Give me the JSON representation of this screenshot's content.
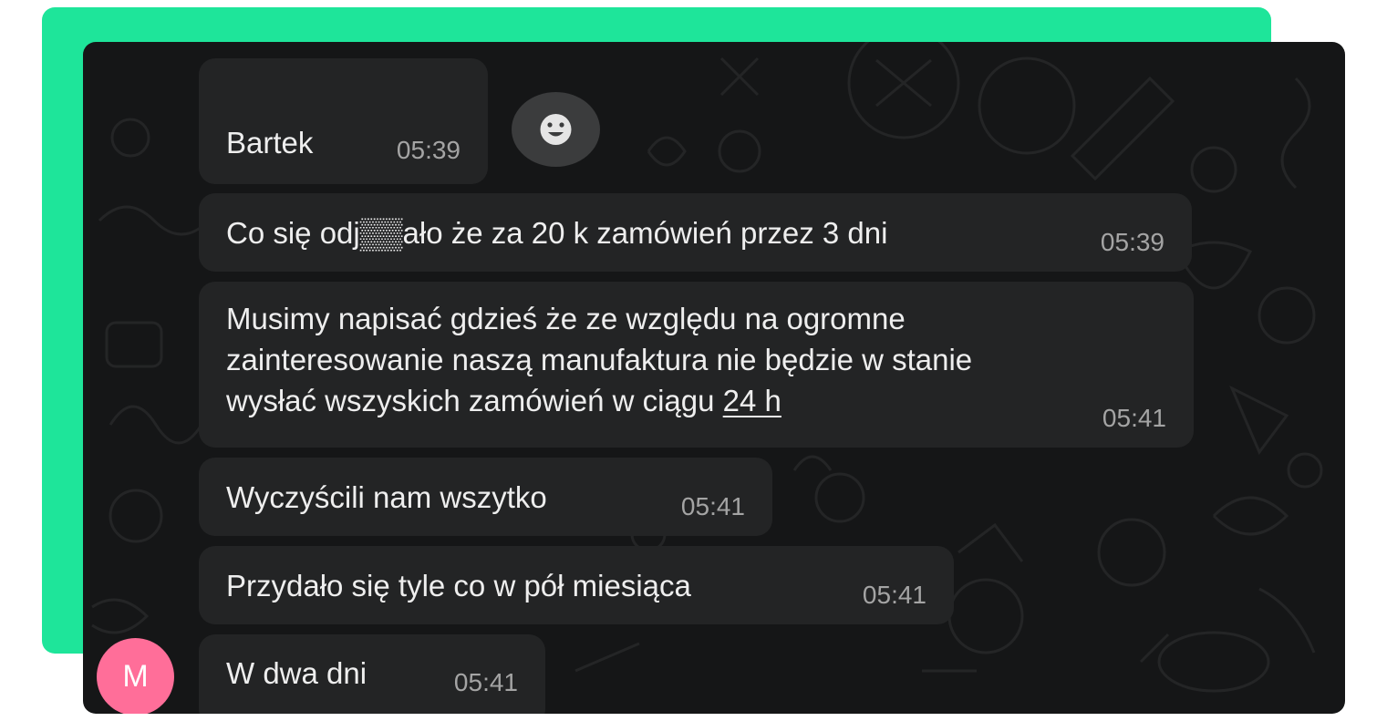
{
  "colors": {
    "accent": "#1ee59a",
    "chat_background": "#151617",
    "bubble": "#232425",
    "timestamp": "#a4a4a4",
    "avatar": "#ff6e99"
  },
  "messages": [
    {
      "text": "Bartek",
      "time": "05:39"
    },
    {
      "text": "Co się odj▒▒ało że za 20 k zamówień przez 3 dni",
      "time": "05:39"
    },
    {
      "lines": [
        "Musimy napisać gdzieś że ze względu na ogromne",
        "zainteresowanie naszą manufaktura nie będzie w stanie",
        "wysłać wszyskich zamówień w ciągu "
      ],
      "link": "24 h",
      "time": "05:41"
    },
    {
      "text": "Wyczyścili nam wszytko",
      "time": "05:41"
    },
    {
      "text": "Przydało się tyle co w pół miesiąca",
      "time": "05:41"
    },
    {
      "text": "W dwa dni",
      "time": "05:41"
    }
  ],
  "reaction": {
    "icon": "smiley-face-icon"
  },
  "sender_avatar": {
    "initial": "M"
  }
}
